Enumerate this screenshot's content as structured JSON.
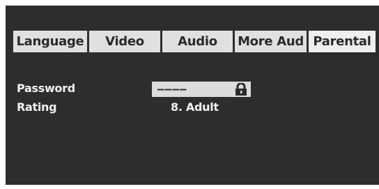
{
  "tabs": [
    {
      "label": "Language",
      "selected": false
    },
    {
      "label": "Video",
      "selected": false
    },
    {
      "label": "Audio",
      "selected": false
    },
    {
      "label": "More Aud",
      "selected": false
    },
    {
      "label": "Parental",
      "selected": true
    }
  ],
  "parental": {
    "password_label": "Password",
    "password_value": "––––",
    "password_icon": "lock-icon",
    "rating_label": "Rating",
    "rating_value": "8. Adult"
  }
}
